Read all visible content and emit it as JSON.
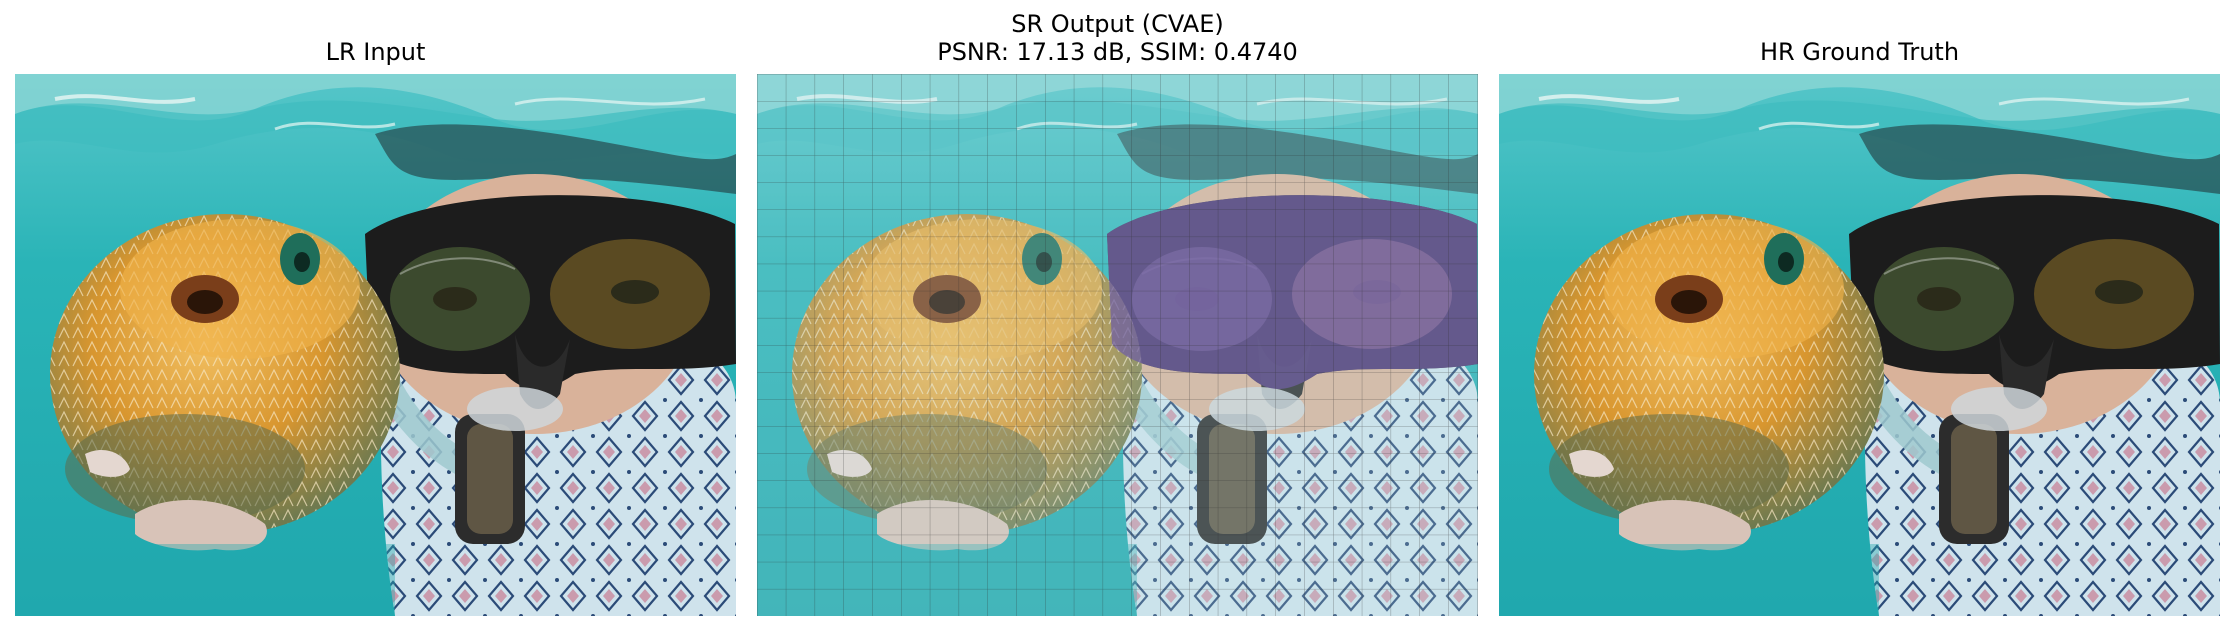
{
  "panels": [
    {
      "title": "LR Input",
      "image": "underwater-snorkeler-with-pufferfish",
      "tint": "none"
    },
    {
      "title_line1": "SR Output (CVAE)",
      "title_line2": "PSNR: 17.13 dB, SSIM: 0.4740",
      "image": "underwater-snorkeler-with-pufferfish",
      "tint": "washed-out with purple mask and visible grid artifacts",
      "psnr_db": 17.13,
      "ssim": 0.474
    },
    {
      "title": "HR Ground Truth",
      "image": "underwater-snorkeler-with-pufferfish",
      "tint": "none"
    }
  ],
  "colors": {
    "water": "#2bb3b8",
    "pufferfish": "#e0a23a",
    "mask": "#1c1c1c",
    "mask_sr": "#5b3b8f",
    "wetsuit": "#cfe6ee"
  }
}
